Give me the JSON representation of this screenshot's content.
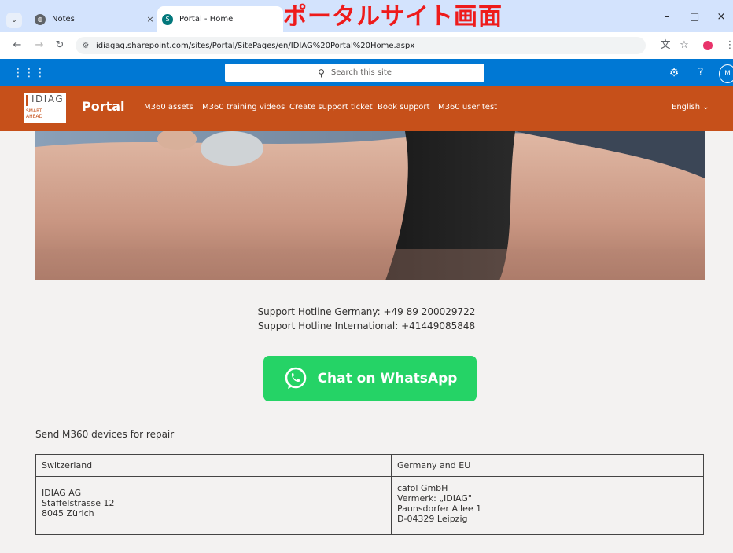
{
  "annotation": "ポータルサイト画面",
  "browser": {
    "tabs": [
      {
        "title": "Notes",
        "close": "×"
      },
      {
        "title": "Portal - Home",
        "close": "×"
      }
    ],
    "url": "idiagag.sharepoint.com/sites/Portal/SitePages/en/IDIAG%20Portal%20Home.aspx",
    "window_controls": {
      "minimize": "–",
      "maximize": "□",
      "close": "×"
    }
  },
  "suitebar": {
    "search_placeholder": "Search this site",
    "help": "?",
    "avatar": "M"
  },
  "site": {
    "logo_word": "IDIAG",
    "logo_tag_line1": "SMART",
    "logo_tag_line2": "AHEAD",
    "title": "Portal",
    "nav": [
      "M360 assets",
      "M360 training videos",
      "Create support ticket",
      "Book support",
      "M360 user test"
    ],
    "language": "English"
  },
  "content": {
    "hotline_germany": "Support Hotline Germany: +49 89 200029722",
    "hotline_international": "Support Hotline International: +41449085848",
    "whatsapp_label": "Chat on WhatsApp",
    "repair_heading": "Send M360 devices for repair",
    "table": {
      "headers": [
        "Switzerland",
        "Germany and EU"
      ],
      "switzerland": [
        "IDIAG AG",
        "Staffelstrasse 12",
        "8045 Zürich"
      ],
      "germany": [
        "cafol GmbH",
        "Vermerk: „IDIAG\"",
        "Paunsdorfer Allee 1",
        "D-04329 Leipzig"
      ]
    }
  },
  "colors": {
    "suitebar": "#0078d4",
    "header": "#c6501a",
    "whatsapp": "#25d366",
    "annotation": "#ee1b1b"
  }
}
